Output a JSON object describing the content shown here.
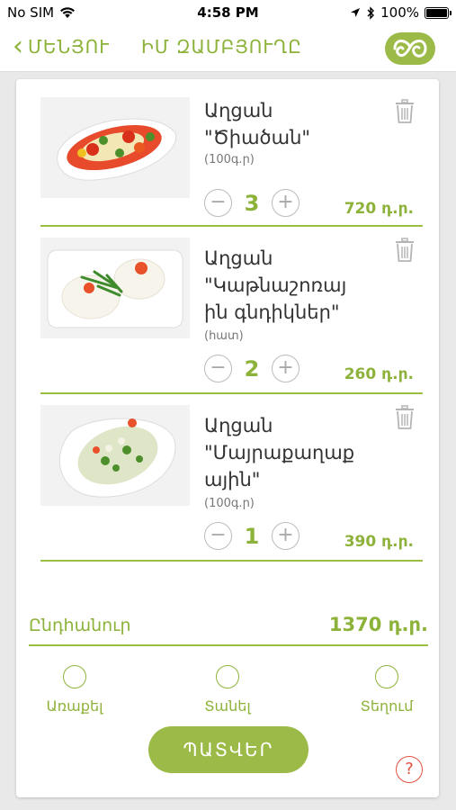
{
  "status_bar": {
    "carrier": "No SIM",
    "time": "4:58 PM",
    "battery": "100%",
    "icons": [
      "wifi-icon",
      "location-arrow-icon",
      "bluetooth-icon",
      "battery-icon"
    ]
  },
  "nav": {
    "back_label": "ՄԵՆՅՈՒ",
    "title": "ԻՄ ԶԱՄԲՅՈՒՂԸ",
    "logo_icon": "logo-icon"
  },
  "colors": {
    "accent": "#8db23a",
    "divider": "#9cbe45",
    "help": "#e2513f"
  },
  "cart": {
    "items": [
      {
        "name_line1": "Աղցան",
        "name_line2": "\"Ծիածան\"",
        "name_line3": "",
        "unit": "(100գ.ր)",
        "quantity": "3",
        "price": "720 դ.ր.",
        "image_icon": "salad-tomato-image"
      },
      {
        "name_line1": "Աղցան",
        "name_line2": "\"Կաթնաշոռայ",
        "name_line3": "ին գնդիկներ\"",
        "unit": "(հատ)",
        "quantity": "2",
        "price": "260 դ.ր.",
        "image_icon": "cheese-balls-image"
      },
      {
        "name_line1": "Աղցան",
        "name_line2": "\"Մայրաքաղաք",
        "name_line3": "ային\"",
        "unit": "(100գ.ր)",
        "quantity": "1",
        "price": "390 դ.ր.",
        "image_icon": "capital-salad-image"
      }
    ],
    "minus_symbol": "−",
    "plus_symbol": "+",
    "total_label": "Ընդհանուր",
    "total_value": "1370 դ.ր."
  },
  "delivery": {
    "options": [
      "Առաքել",
      "Տանել",
      "Տեղում"
    ]
  },
  "actions": {
    "order_label": "ՊԱՏՎԵՐ",
    "help_symbol": "?"
  }
}
